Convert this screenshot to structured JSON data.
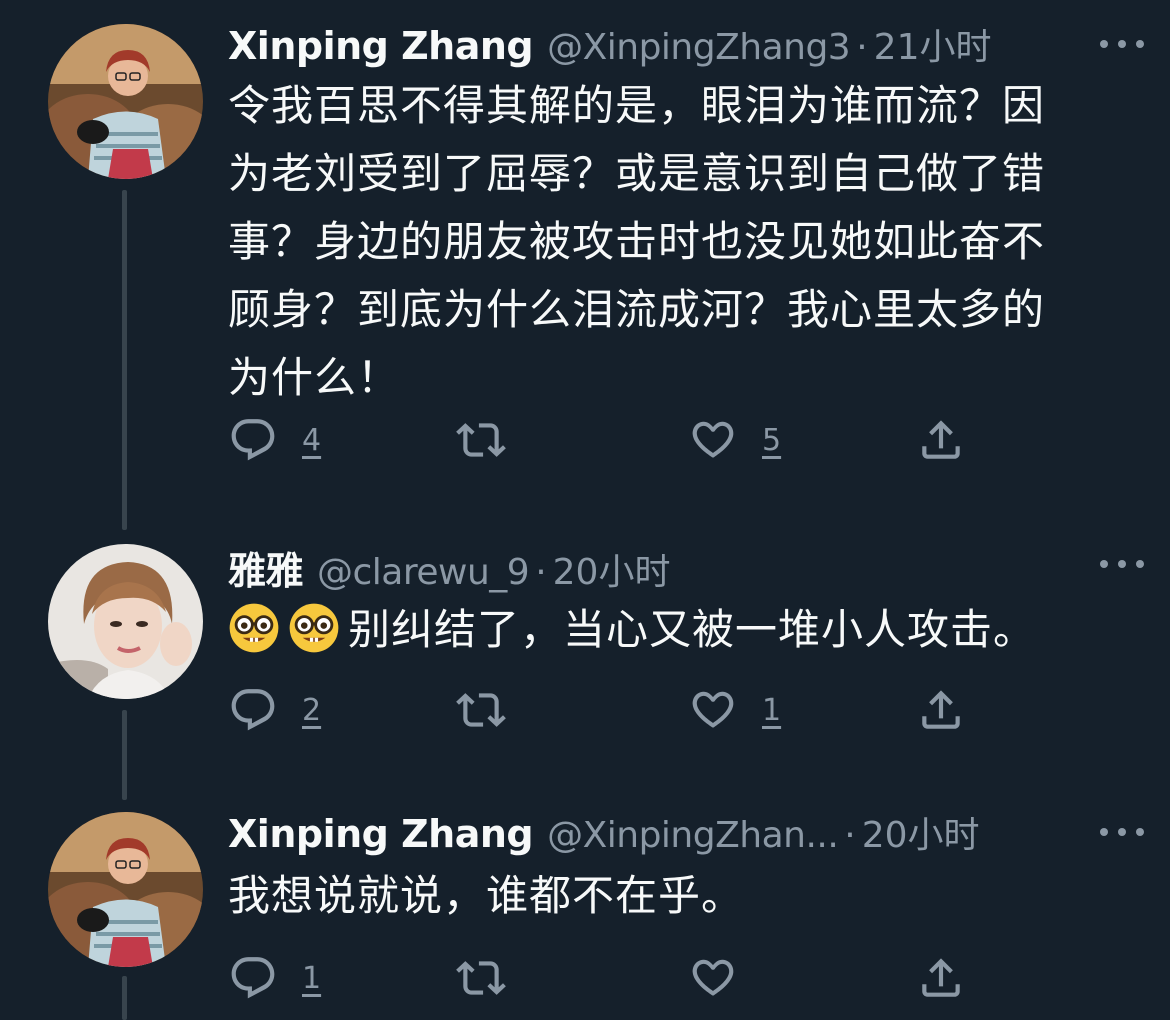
{
  "tweets": [
    {
      "name": "Xinping Zhang",
      "handle": "@XinpingZhang3",
      "separator": "·",
      "time": "21小时",
      "text_lines": [
        "令我百思不得其解的是，眼泪为谁而流？因",
        "为老刘受到了屈辱？或是意识到自己做了错",
        "事？身边的朋友被攻击时也没见她如此奋不",
        "顾身？到底为什么泪流成河？我心里太多的",
        "为什么！"
      ],
      "reply_count": "4",
      "retweet_count": "",
      "like_count": "5",
      "avatar": "profile-photo-woman-glasses",
      "more_icon": "more-dots-icon"
    },
    {
      "name": "雅雅",
      "handle": "@clarewu_9",
      "separator": "·",
      "time": "20小时",
      "emoji": [
        "nerd-face-emoji",
        "nerd-face-emoji"
      ],
      "text": "别纠结了，当心又被一堆小人攻击。",
      "reply_count": "2",
      "retweet_count": "",
      "like_count": "1",
      "avatar": "profile-photo-woman-short-hair",
      "more_icon": "more-dots-icon"
    },
    {
      "name": "Xinping Zhang",
      "handle": "@XinpingZhan...",
      "separator": "·",
      "time": "20小时",
      "text": "我想说就说，谁都不在乎。",
      "reply_count": "1",
      "retweet_count": "",
      "like_count": "",
      "avatar": "profile-photo-woman-glasses",
      "more_icon": "more-dots-icon"
    }
  ],
  "colors": {
    "background": "#15202b",
    "primary_text": "#f7f9f9",
    "secondary_text": "#8b98a5",
    "thread_line": "#38444d"
  },
  "icons": [
    "reply-icon",
    "retweet-icon",
    "like-icon",
    "share-icon"
  ]
}
